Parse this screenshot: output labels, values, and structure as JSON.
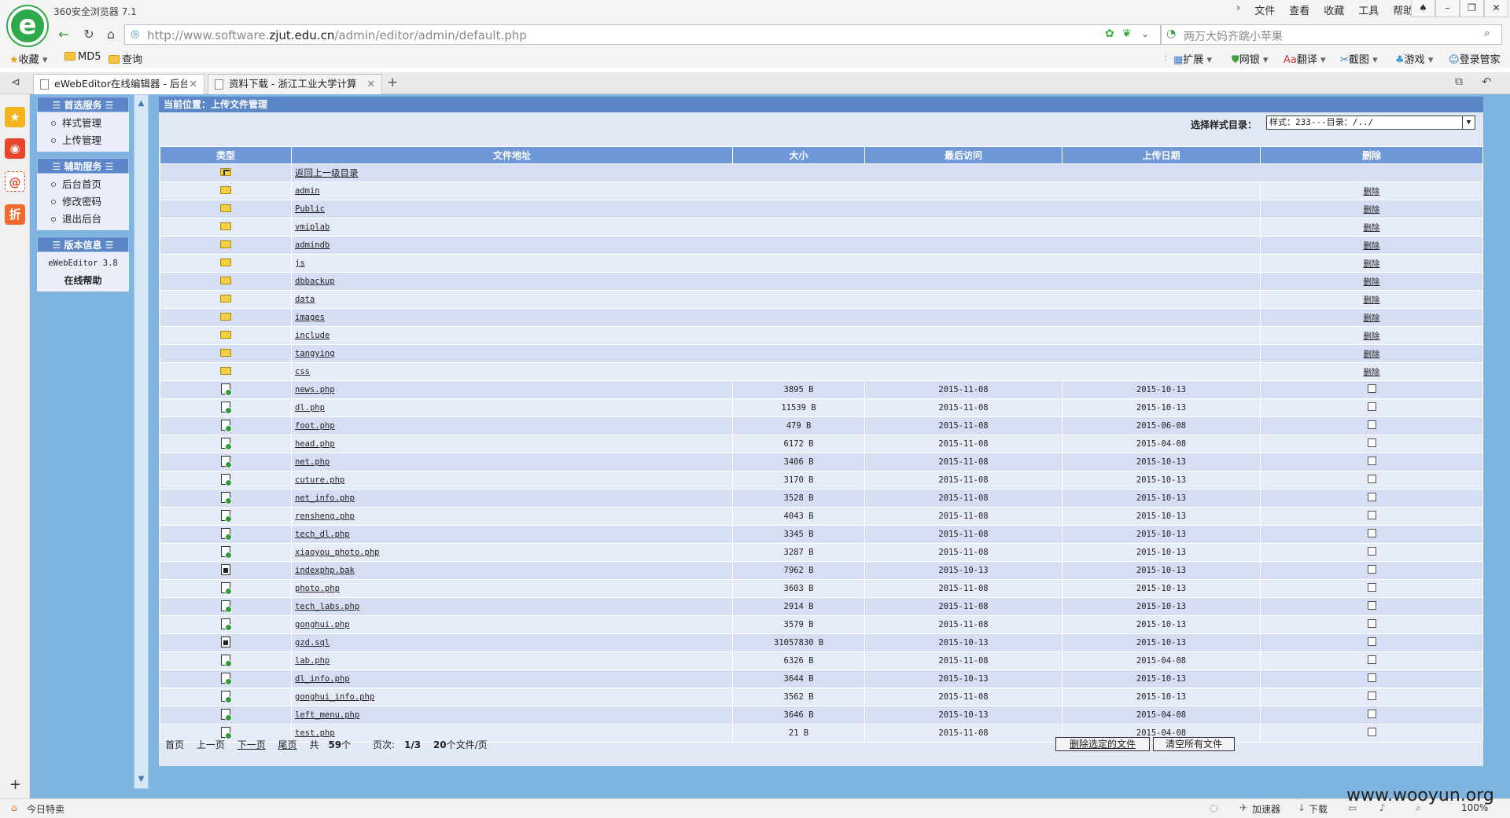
{
  "browser": {
    "app_title": "360安全浏览器 7.1",
    "menu": [
      "文件",
      "查看",
      "收藏",
      "工具",
      "帮助"
    ],
    "url_prefix": "http://www.software.",
    "url_domain": "zjut.edu.cn",
    "url_path": "/admin/editor/admin/default.php",
    "search_placeholder": "两万大妈齐跳小苹果",
    "bookmarks": {
      "favorites": "收藏",
      "md5": "MD5",
      "query": "查询"
    },
    "toolbar": {
      "extend": "扩展",
      "bank": "网银",
      "translate": "翻译",
      "screenshot": "截图",
      "games": "游戏",
      "login": "登录管家"
    },
    "tabs": [
      {
        "label": "eWebEditor在线编辑器 - 后台"
      },
      {
        "label": "资料下载 - 浙江工业大学计算"
      }
    ],
    "status": {
      "today": "今日特卖",
      "accelerator": "加速器",
      "download": "下载",
      "zoom": "100%"
    },
    "watermark": "www.wooyun.org"
  },
  "sidebar": {
    "section1": {
      "title": "首选服务",
      "items": [
        "样式管理",
        "上传管理"
      ]
    },
    "section2": {
      "title": "辅助服务",
      "items": [
        "后台首页",
        "修改密码",
        "退出后台"
      ]
    },
    "section3": {
      "title": "版本信息",
      "version": "eWebEditor 3.8",
      "help": "在线帮助"
    }
  },
  "main": {
    "location": "当前位置：上传文件管理",
    "style_select_label": "选择样式目录：",
    "style_select_value": "样式：233---目录：/../",
    "columns": [
      "类型",
      "文件地址",
      "大小",
      "最后访问",
      "上传日期",
      "删除"
    ],
    "parent_dir": "返回上一级目录",
    "delete_label": "删除",
    "folders": [
      "admin",
      "Public",
      "vmiplab",
      "admindb",
      "js",
      "dbbackup",
      "data",
      "images",
      "include",
      "tangying",
      "css"
    ],
    "files": [
      {
        "name": "news.php",
        "size": "3895 B",
        "accessed": "2015-11-08",
        "uploaded": "2015-10-13",
        "icon": "php"
      },
      {
        "name": "dl.php",
        "size": "11539 B",
        "accessed": "2015-11-08",
        "uploaded": "2015-10-13",
        "icon": "php"
      },
      {
        "name": "foot.php",
        "size": "479 B",
        "accessed": "2015-11-08",
        "uploaded": "2015-06-08",
        "icon": "php"
      },
      {
        "name": "head.php",
        "size": "6172 B",
        "accessed": "2015-11-08",
        "uploaded": "2015-04-08",
        "icon": "php"
      },
      {
        "name": "net.php",
        "size": "3406 B",
        "accessed": "2015-11-08",
        "uploaded": "2015-10-13",
        "icon": "php"
      },
      {
        "name": "cuture.php",
        "size": "3170 B",
        "accessed": "2015-11-08",
        "uploaded": "2015-10-13",
        "icon": "php"
      },
      {
        "name": "net_info.php",
        "size": "3528 B",
        "accessed": "2015-11-08",
        "uploaded": "2015-10-13",
        "icon": "php"
      },
      {
        "name": "rensheng.php",
        "size": "4043 B",
        "accessed": "2015-11-08",
        "uploaded": "2015-10-13",
        "icon": "php"
      },
      {
        "name": "tech_dl.php",
        "size": "3345 B",
        "accessed": "2015-11-08",
        "uploaded": "2015-10-13",
        "icon": "php"
      },
      {
        "name": "xiaoyou_photo.php",
        "size": "3287 B",
        "accessed": "2015-11-08",
        "uploaded": "2015-10-13",
        "icon": "php"
      },
      {
        "name": "indexphp.bak",
        "size": "7962 B",
        "accessed": "2015-10-13",
        "uploaded": "2015-10-13",
        "icon": "bin"
      },
      {
        "name": "photo.php",
        "size": "3603 B",
        "accessed": "2015-11-08",
        "uploaded": "2015-10-13",
        "icon": "php"
      },
      {
        "name": "tech_labs.php",
        "size": "2914 B",
        "accessed": "2015-11-08",
        "uploaded": "2015-10-13",
        "icon": "php"
      },
      {
        "name": "gonghui.php",
        "size": "3579 B",
        "accessed": "2015-11-08",
        "uploaded": "2015-10-13",
        "icon": "php"
      },
      {
        "name": "gzd.sql",
        "size": "31057830 B",
        "accessed": "2015-10-13",
        "uploaded": "2015-10-13",
        "icon": "bin"
      },
      {
        "name": "lab.php",
        "size": "6326 B",
        "accessed": "2015-11-08",
        "uploaded": "2015-04-08",
        "icon": "php"
      },
      {
        "name": "dl_info.php",
        "size": "3644 B",
        "accessed": "2015-10-13",
        "uploaded": "2015-10-13",
        "icon": "php"
      },
      {
        "name": "gonghui_info.php",
        "size": "3562 B",
        "accessed": "2015-11-08",
        "uploaded": "2015-10-13",
        "icon": "php"
      },
      {
        "name": "left_menu.php",
        "size": "3646 B",
        "accessed": "2015-10-13",
        "uploaded": "2015-04-08",
        "icon": "php"
      },
      {
        "name": "test.php",
        "size": "21 B",
        "accessed": "2015-11-08",
        "uploaded": "2015-04-08",
        "icon": "php"
      }
    ],
    "pager": {
      "first": "首页",
      "prev": "上一页",
      "next": "下一页",
      "last": "尾页",
      "total_prefix": "共",
      "total": "59",
      "total_suffix": "个",
      "page_label": "页次:",
      "page": "1/3",
      "per_page": "20",
      "per_page_suffix": "个文件/页"
    },
    "delete_selected": "删除选定的文件",
    "clear_all": "清空所有文件"
  }
}
